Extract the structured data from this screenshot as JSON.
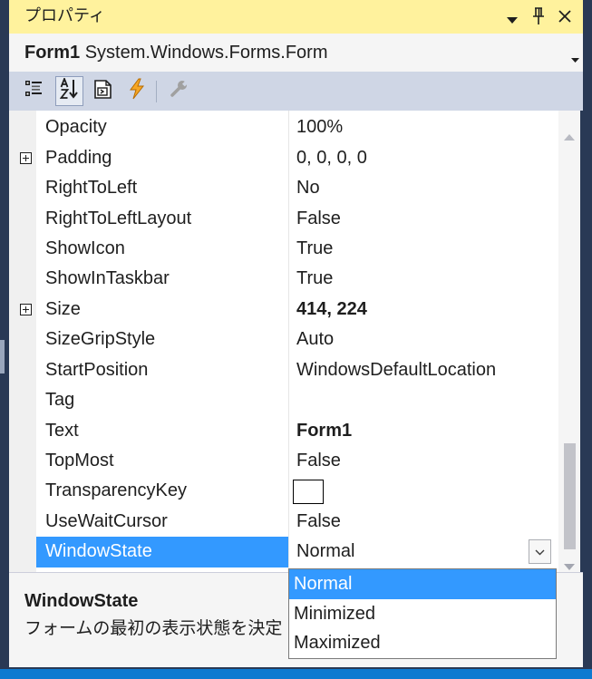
{
  "theme": {
    "selection": "#3399FF",
    "title_bar": "#FFF29D",
    "toolbar": "#CFD6E5",
    "frame": "#293955",
    "status_strip": "#0E7AD0"
  },
  "window": {
    "title": "プロパティ",
    "title_icons": [
      "dropdown-triangle-icon",
      "pin-icon",
      "close-icon"
    ]
  },
  "object_selector": {
    "name": "Form1",
    "type": "System.Windows.Forms.Form",
    "icon": "chevron-down-icon"
  },
  "toolbar": {
    "buttons": [
      {
        "icon": "categorized-icon",
        "checked": false
      },
      {
        "icon": "alphabetical-sort-icon",
        "checked": true
      },
      {
        "icon": "property-pages-icon",
        "checked": false
      },
      {
        "icon": "events-lightning-icon",
        "checked": false
      },
      {
        "icon": "wrench-icon",
        "checked": false,
        "disabled": true
      }
    ]
  },
  "properties": [
    {
      "name": "Opacity",
      "value": "100%"
    },
    {
      "name": "Padding",
      "value": "0, 0, 0, 0",
      "expandable": true
    },
    {
      "name": "RightToLeft",
      "value": "No"
    },
    {
      "name": "RightToLeftLayout",
      "value": "False"
    },
    {
      "name": "ShowIcon",
      "value": "True"
    },
    {
      "name": "ShowInTaskbar",
      "value": "True"
    },
    {
      "name": "Size",
      "value": "414, 224",
      "expandable": true,
      "modified": true
    },
    {
      "name": "SizeGripStyle",
      "value": "Auto"
    },
    {
      "name": "StartPosition",
      "value": "WindowsDefaultLocation"
    },
    {
      "name": "Tag",
      "value": ""
    },
    {
      "name": "Text",
      "value": "Form1",
      "modified": true
    },
    {
      "name": "TopMost",
      "value": "False"
    },
    {
      "name": "TransparencyKey",
      "value": "",
      "swatch": "#FFFFFF"
    },
    {
      "name": "UseWaitCursor",
      "value": "False"
    },
    {
      "name": "WindowState",
      "value": "Normal",
      "selected": true
    }
  ],
  "dropdown": {
    "options": [
      "Normal",
      "Minimized",
      "Maximized"
    ],
    "highlighted_index": 0
  },
  "scrollbar": {
    "scroll_position": 1.0
  },
  "description": {
    "title": "WindowState",
    "text": "フォームの最初の表示状態を決定"
  }
}
